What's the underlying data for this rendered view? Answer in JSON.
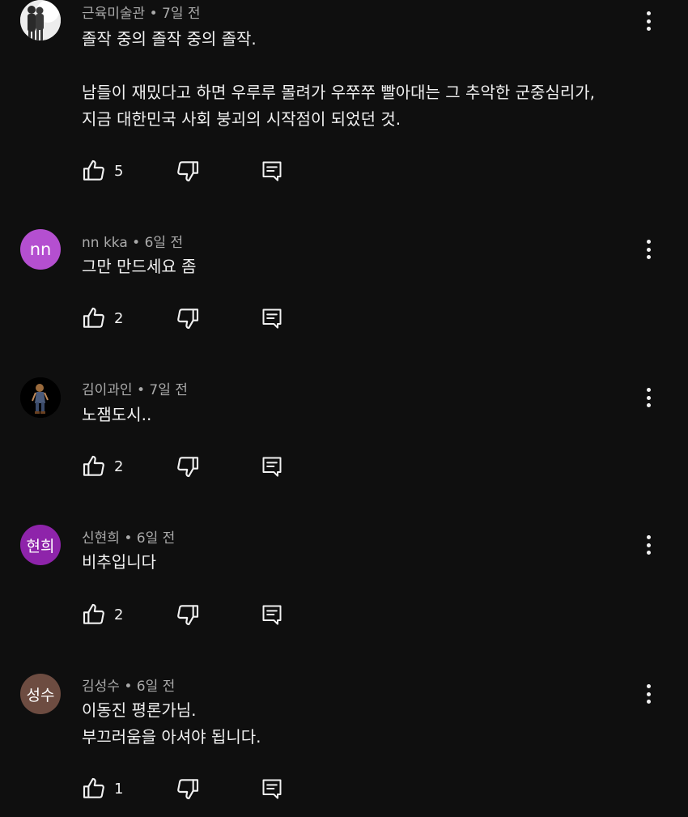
{
  "comments": [
    {
      "author": "근육미술관",
      "time": "7일 전",
      "text": "졸작 중의 졸작 중의 졸작.\n\n남들이 재밌다고 하면 우루루 몰려가 우쭈쭈 빨아대는 그 추악한 군중심리가,\n지금 대한민국 사회 붕괴의 시작점이 되었던 것.",
      "likes": "5",
      "avatar_text": "",
      "avatar_color": "#1c1c1c"
    },
    {
      "author": "nn kka",
      "time": "6일 전",
      "text": "그만 만드세요 좀",
      "likes": "2",
      "avatar_text": "nn",
      "avatar_color": "#b44fd0"
    },
    {
      "author": "김이과인",
      "time": "7일 전",
      "text": "노잼도시..",
      "likes": "2",
      "avatar_text": "",
      "avatar_color": "#000000"
    },
    {
      "author": "신현희",
      "time": "6일 전",
      "text": "비추입니다",
      "likes": "2",
      "avatar_text": "현희",
      "avatar_color": "#8e24aa"
    },
    {
      "author": "김성수",
      "time": "6일 전",
      "text": "이동진 평론가님.\n부끄러움을 아셔야 됩니다.",
      "likes": "1",
      "avatar_text": "성수",
      "avatar_color": "#6d4c41"
    }
  ],
  "separator": "•",
  "icons": {
    "like": "thumb-up-icon",
    "dislike": "thumb-down-icon",
    "reply": "reply-comment-icon",
    "more": "more-vert-icon"
  },
  "colors": {
    "background": "#0f0f0f",
    "text": "#f1f1f1",
    "meta": "#aaaaaa"
  }
}
